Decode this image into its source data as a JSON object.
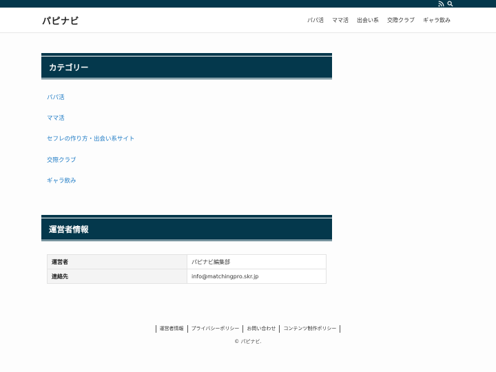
{
  "site": {
    "logo": "パピナビ"
  },
  "nav": {
    "items": [
      "パパ活",
      "ママ活",
      "出会い系",
      "交際クラブ",
      "ギャラ飲み"
    ]
  },
  "icons": {
    "rss": "rss-icon",
    "search": "search-icon"
  },
  "colors": {
    "brand": "#04384c",
    "link": "#1e7bc5"
  },
  "category_section": {
    "title": "カテゴリー",
    "items": [
      "パパ活",
      "ママ活",
      "セフレの作り方・出会い系サイト",
      "交際クラブ",
      "ギャラ飲み"
    ]
  },
  "operator_section": {
    "title": "運営者情報",
    "rows": [
      {
        "key": "運営者",
        "value": "パピナビ編集部"
      },
      {
        "key": "連絡先",
        "value": "info@matchingpro.skr.jp"
      }
    ]
  },
  "footer": {
    "links": [
      "運営者情報",
      "プライバシーポリシー",
      "お問い合わせ",
      "コンテンツ制作ポリシー"
    ],
    "copyright": "© パピナビ."
  }
}
